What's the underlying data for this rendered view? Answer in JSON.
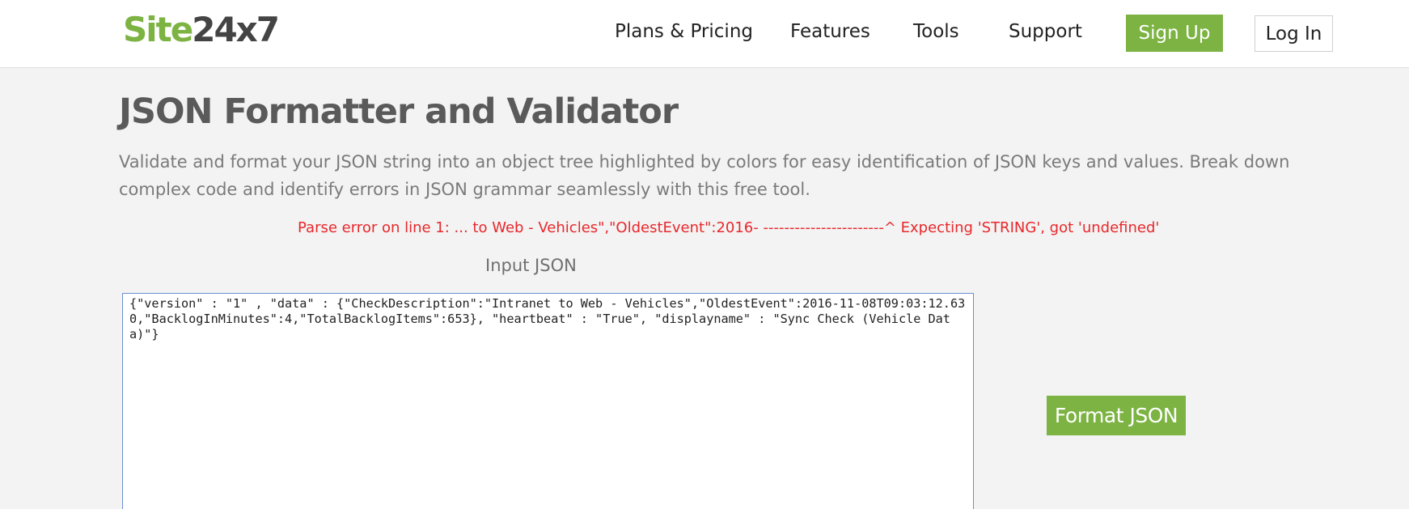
{
  "header": {
    "logo": {
      "part1": "Site",
      "part2": "24x7"
    },
    "nav": [
      {
        "label": "Plans & Pricing"
      },
      {
        "label": "Features"
      },
      {
        "label": "Tools"
      },
      {
        "label": "Support"
      }
    ],
    "signup_label": "Sign Up",
    "login_label": "Log In"
  },
  "main": {
    "title": "JSON Formatter and Validator",
    "description": "Validate and format your JSON string into an object tree highlighted by colors for easy identification of JSON keys and values. Break down complex code and identify errors in JSON grammar seamlessly with this free tool.",
    "parse_error": "Parse error on line 1: ... to Web - Vehicles\",\"OldestEvent\":2016- -----------------------^ Expecting 'STRING', got 'undefined'",
    "input_label": "Input JSON",
    "input_value": "{\"version\" : \"1\" , \"data\" : {\"CheckDescription\":\"Intranet to Web - Vehicles\",\"OldestEvent\":2016-11-08T09:03:12.630,\"BacklogInMinutes\":4,\"TotalBacklogItems\":653}, \"heartbeat\" : \"True\", \"displayname\" : \"Sync Check (Vehicle Data)\"}",
    "format_button_label": "Format JSON"
  },
  "colors": {
    "brand_green": "#7cb342",
    "error_red": "#e8282d",
    "input_border": "#6b8fd6",
    "page_bg": "#f2f3f2"
  }
}
